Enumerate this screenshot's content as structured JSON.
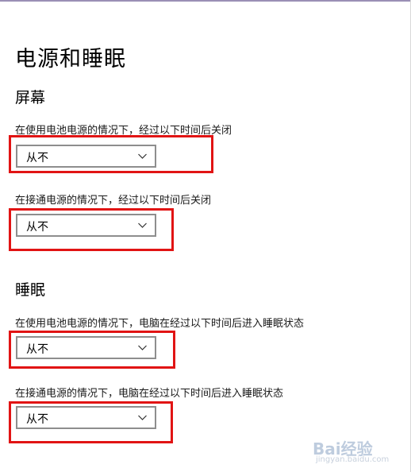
{
  "page": {
    "title": "电源和睡眠"
  },
  "screen_section": {
    "title": "屏幕",
    "settings": [
      {
        "label": "在使用电池电源的情况下，经过以下时间后关闭",
        "value": "从不"
      },
      {
        "label": "在接通电源的情况下，经过以下时间后关闭",
        "value": "从不"
      }
    ]
  },
  "sleep_section": {
    "title": "睡眠",
    "settings": [
      {
        "label": "在使用电池电源的情况下，电脑在经过以下时间后进入睡眠状态",
        "value": "从不"
      },
      {
        "label": "在接通电源的情况下，电脑在经过以下时间后进入睡眠状态",
        "value": "从不"
      }
    ]
  },
  "watermark": {
    "logo": "Bai经验",
    "site": "jingyan.baidu.com"
  },
  "colors": {
    "highlight": "#e11414",
    "dropdown_border": "#8e8e8e"
  }
}
